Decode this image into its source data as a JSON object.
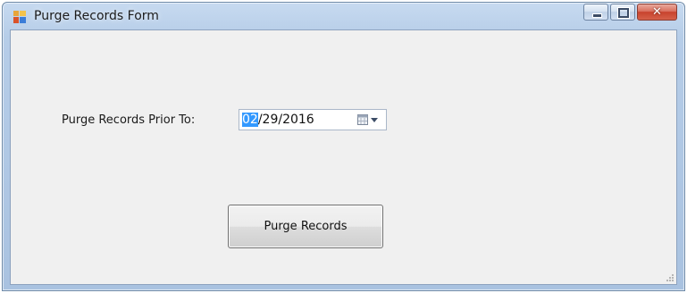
{
  "window": {
    "title": "Purge Records Form",
    "icon": "windows-form-icon",
    "caption_buttons": {
      "minimize": "minimize-icon",
      "maximize": "maximize-icon",
      "close_glyph": "✕"
    }
  },
  "form": {
    "purge_label": "Purge Records Prior To:",
    "date_month": "02",
    "date_rest": "/29/2016",
    "calendar_icon": "calendar-icon",
    "purge_button_label": "Purge Records"
  },
  "colors": {
    "selection": "#3399ff",
    "client_bg": "#f0f0f0",
    "close_button": "#c8432d"
  }
}
